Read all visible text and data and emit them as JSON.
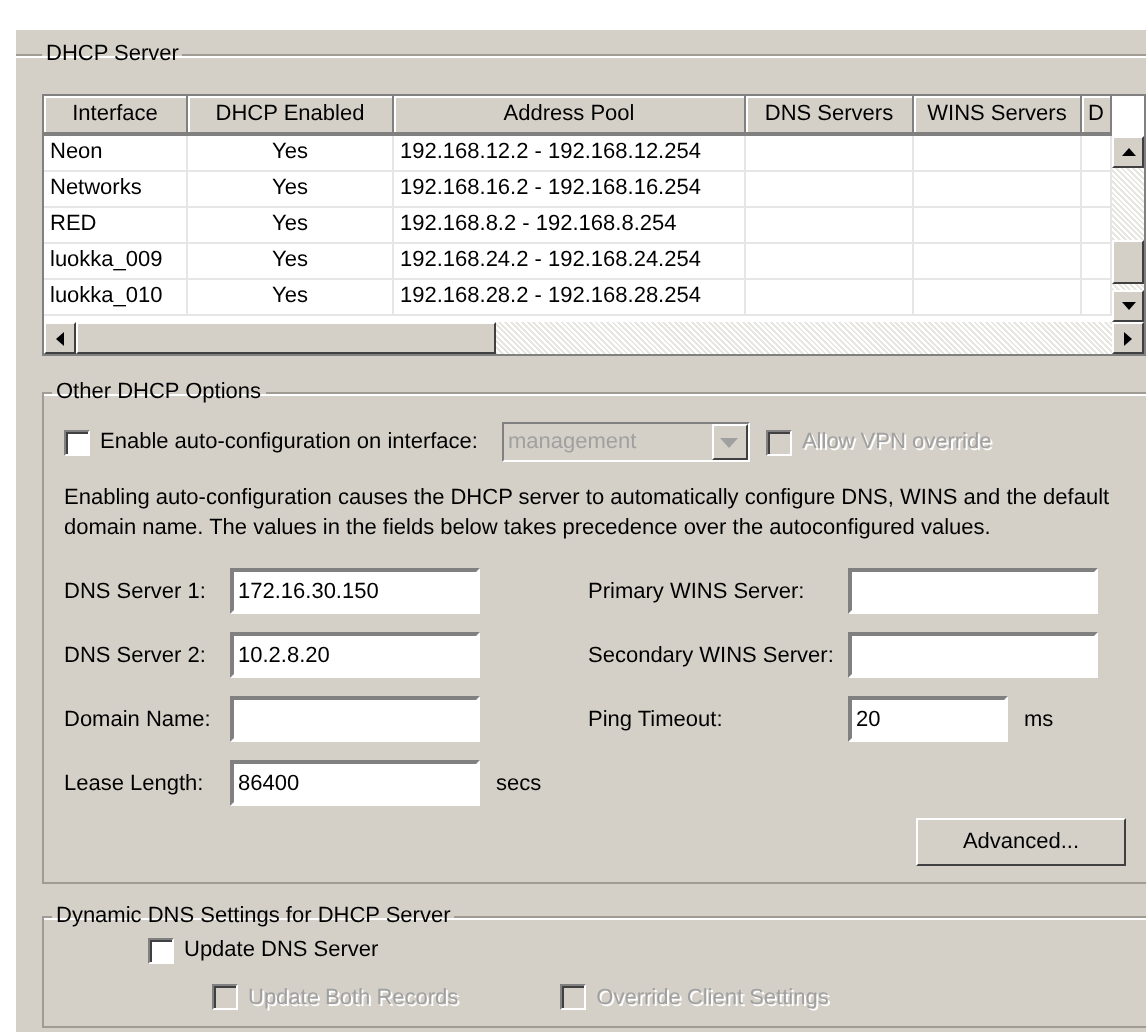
{
  "group_title": "DHCP Server",
  "table": {
    "columns": [
      "Interface",
      "DHCP Enabled",
      "Address Pool",
      "DNS Servers",
      "WINS Servers",
      "D"
    ],
    "rows": [
      [
        "Neon",
        "Yes",
        "192.168.12.2 - 192.168.12.254"
      ],
      [
        "Networks",
        "Yes",
        "192.168.16.2 - 192.168.16.254"
      ],
      [
        "RED",
        "Yes",
        "192.168.8.2 - 192.168.8.254"
      ],
      [
        "luokka_009",
        "Yes",
        "192.168.24.2 - 192.168.24.254"
      ],
      [
        "luokka_010",
        "Yes",
        "192.168.28.2 - 192.168.28.254"
      ]
    ]
  },
  "other_options": {
    "title": "Other DHCP Options",
    "auto_config": {
      "label": "Enable auto-configuration on interface:",
      "checked": false,
      "disabled": false
    },
    "interface_dropdown": {
      "value": "management",
      "disabled": true
    },
    "vpn_override": {
      "label": "Allow VPN override",
      "checked": false,
      "disabled": true
    },
    "note": "Enabling auto-configuration causes the DHCP server to automatically configure DNS, WINS and the default domain name. The values in the fields below takes precedence over the autoconfigured values.",
    "left_fields": [
      {
        "label": "DNS Server 1:",
        "value": "172.16.30.150"
      },
      {
        "label": "DNS Server 2:",
        "value": "10.2.8.20"
      },
      {
        "label": "Domain Name:"
      },
      {
        "label": "Lease Length:",
        "value": "86400",
        "unit": "secs"
      }
    ],
    "right_fields": [
      {
        "label": "Primary WINS Server:"
      },
      {
        "label": "Secondary WINS Server:"
      },
      {
        "label": "Ping Timeout:",
        "value": "20",
        "unit": "ms"
      }
    ],
    "advanced_button": "Advanced..."
  },
  "dynamic_dns": {
    "title": "Dynamic DNS Settings for DHCP Server",
    "update_dns": {
      "label": "Update DNS Server",
      "checked": false,
      "disabled": false
    },
    "options": [
      {
        "label": "Update Both Records",
        "checked": false,
        "disabled": true
      },
      {
        "label": "Override Client Settings",
        "checked": false,
        "disabled": true
      }
    ]
  }
}
